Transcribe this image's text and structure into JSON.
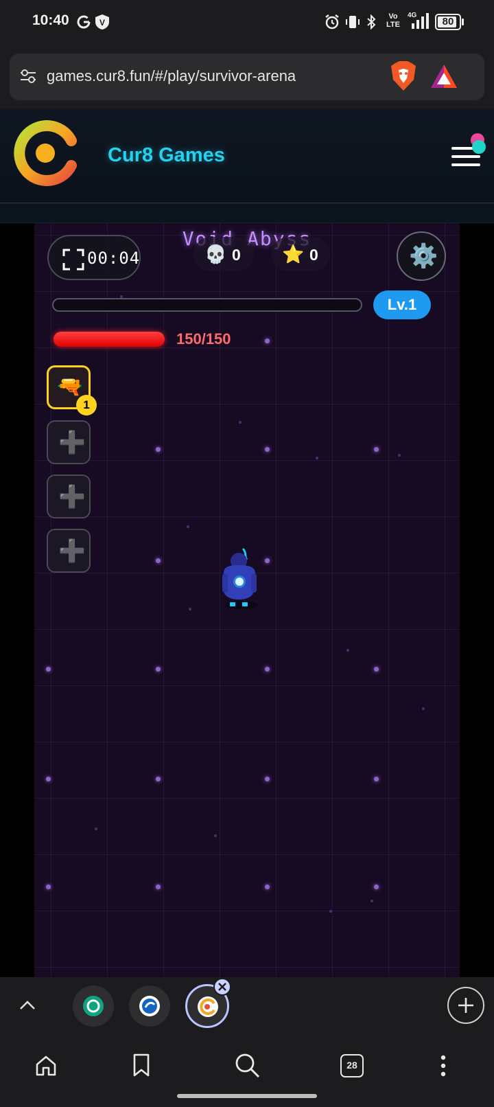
{
  "status_bar": {
    "time": "10:40",
    "battery": "80",
    "network": "4G",
    "volte": "Vo LTE",
    "icons": [
      "google-icon",
      "vpn-icon",
      "alarm-icon",
      "vibrate-icon",
      "bluetooth-icon",
      "volte-icon",
      "signal-icon",
      "battery-icon"
    ]
  },
  "browser": {
    "url": "games.cur8.fun/#/play/survivor-arena",
    "icons": [
      "site-settings-icon",
      "brave-shields-icon",
      "brave-rewards-icon"
    ]
  },
  "site": {
    "title": "Cur8 Games"
  },
  "game": {
    "timer": "00:04",
    "level_name": "Void Abyss",
    "kills": "0",
    "kill_icon": "💀",
    "stars": "0",
    "star_icon": "⭐",
    "settings_icon": "⚙️",
    "xp_progress": 0.0,
    "level_badge": "Lv.1",
    "hp_text": "150/150",
    "hp_fraction": 1.0,
    "weapon_icon": "🔫",
    "weapon_level": "1",
    "empty_slot_icon": "➕"
  },
  "tabs": {
    "open_tab_count": "28",
    "tab_icons": [
      "chatgpt-tab-icon",
      "app-tab-icon",
      "cur8-tab-icon"
    ]
  },
  "colors": {
    "accent": "#22d3ee",
    "level_name": "#c58cff",
    "level_badge": "#1e9bf0",
    "hp": "#ff2a2a",
    "weapon_slot_border": "#ffd21e",
    "arena_bg": "#170b24"
  }
}
